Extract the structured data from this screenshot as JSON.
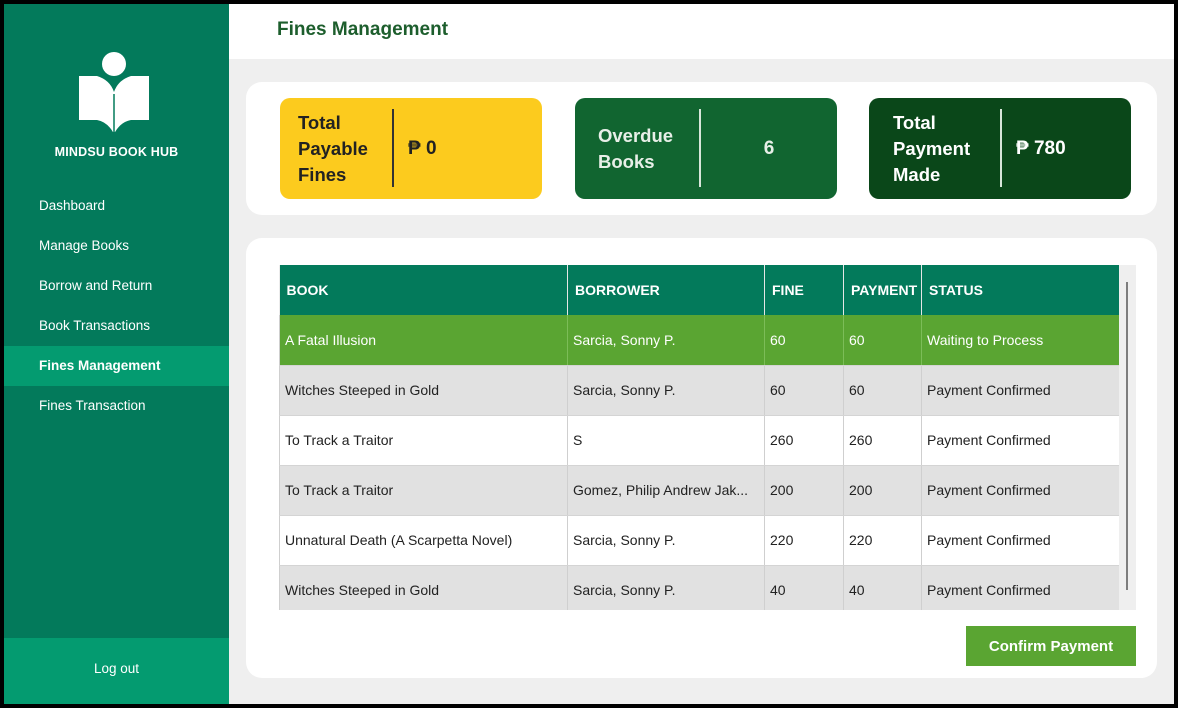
{
  "sidebar": {
    "brand": "MINDSU BOOK HUB",
    "logo_icon": "book-reader-icon",
    "items": [
      {
        "label": "Dashboard"
      },
      {
        "label": "Manage Books"
      },
      {
        "label": "Borrow and Return"
      },
      {
        "label": "Book Transactions"
      },
      {
        "label": "Fines Management",
        "active": true
      },
      {
        "label": "Fines Transaction"
      }
    ],
    "logout_label": "Log out"
  },
  "header": {
    "title": "Fines Management"
  },
  "stats": [
    {
      "label": "Total Payable Fines",
      "value": "₱ 0"
    },
    {
      "label": "Overdue Books",
      "value": "6"
    },
    {
      "label": "Total Payment Made",
      "value": "₱ 780"
    }
  ],
  "table": {
    "columns": [
      "BOOK",
      "BORROWER",
      "FINE",
      "PAYMENT",
      "STATUS"
    ],
    "rows": [
      {
        "book": "A Fatal Illusion",
        "borrower": "Sarcia, Sonny P.",
        "fine": "60",
        "payment": "60",
        "status": "Waiting to Process",
        "selected": true
      },
      {
        "book": "Witches Steeped in Gold",
        "borrower": "Sarcia, Sonny P.",
        "fine": "60",
        "payment": "60",
        "status": "Payment Confirmed"
      },
      {
        "book": "To Track a Traitor",
        "borrower": "S",
        "fine": "260",
        "payment": "260",
        "status": "Payment Confirmed"
      },
      {
        "book": "To Track a Traitor",
        "borrower": "Gomez, Philip Andrew Jak...",
        "fine": "200",
        "payment": "200",
        "status": "Payment Confirmed"
      },
      {
        "book": "Unnatural Death (A Scarpetta Novel)",
        "borrower": "Sarcia, Sonny P.",
        "fine": "220",
        "payment": "220",
        "status": "Payment Confirmed"
      },
      {
        "book": "Witches Steeped in Gold",
        "borrower": "Sarcia, Sonny P.",
        "fine": "40",
        "payment": "40",
        "status": "Payment Confirmed"
      }
    ]
  },
  "actions": {
    "confirm_label": "Confirm Payment"
  },
  "colors": {
    "sidebar": "#037a5b",
    "sidebar_active": "#049b70",
    "title": "#1d5e2d",
    "card_payable": "#fccb1e",
    "card_overdue": "#116530",
    "card_payment": "#0a4719",
    "selected_row": "#5aa532",
    "button": "#5aa532"
  }
}
